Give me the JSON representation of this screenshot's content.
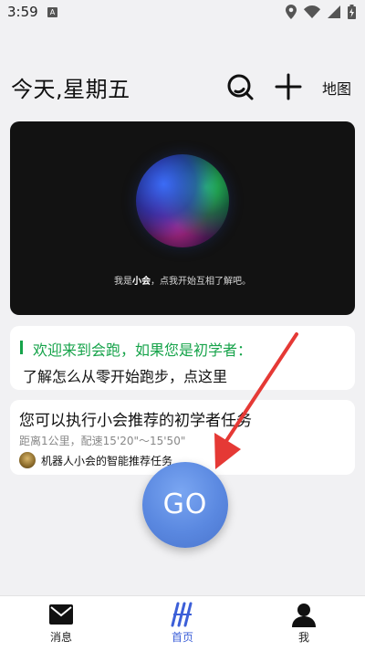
{
  "status_bar": {
    "time": "3:59",
    "notif_badge": "A"
  },
  "header": {
    "title": "今天,星期五",
    "map_label": "地图"
  },
  "hero": {
    "caption_prefix": "我是",
    "caption_name": "小会",
    "caption_suffix": "，点我开始互相了解吧。"
  },
  "welcome_card": {
    "line1": "欢迎来到会跑，如果您是初学者：",
    "line2": "了解怎么从零开始跑步，点这里",
    "accent_color": "#16a34a"
  },
  "task_card": {
    "title": "您可以执行小会推荐的初学者任务",
    "meta": "距离1公里，配速15'20\"～15'50\"",
    "source": "机器人小会的智能推荐任务"
  },
  "go_button": {
    "label": "GO",
    "color": "#5a88e0"
  },
  "bottom_nav": {
    "items": [
      {
        "label": "消息",
        "icon": "mail-icon"
      },
      {
        "label": "首页",
        "icon": "home-logo-icon",
        "active": true
      },
      {
        "label": "我",
        "icon": "person-icon"
      }
    ],
    "active_color": "#3c5fd8"
  },
  "annotation": {
    "arrow_color": "#e53935"
  }
}
